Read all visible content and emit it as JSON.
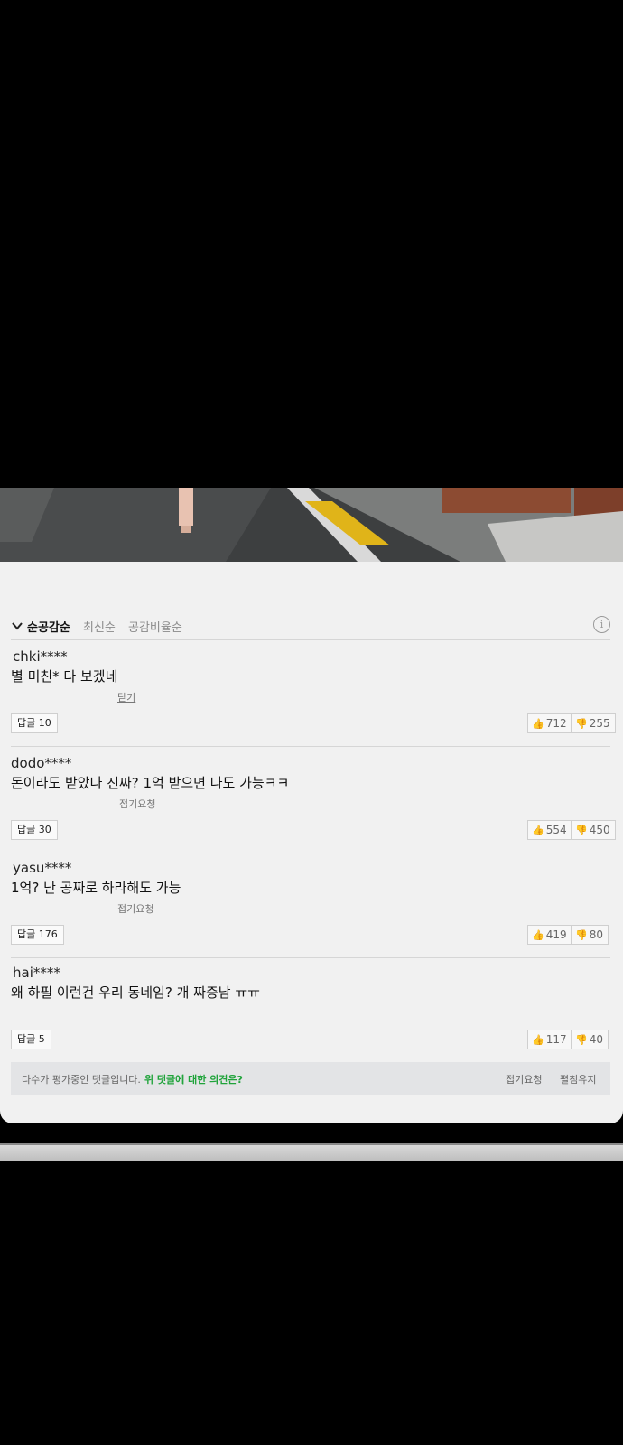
{
  "sort": {
    "options": [
      "순공감순",
      "최신순",
      "공감비율순"
    ],
    "active": "순공감순",
    "info_icon": "info-icon"
  },
  "comments": [
    {
      "user": "chki****",
      "text": "별 미친* 다 보겠네",
      "fold_label": "닫기",
      "reply_label": "답글 10",
      "likes": "712",
      "dislikes": "255"
    },
    {
      "user": "dodo****",
      "text": "돈이라도 받았나 진짜? 1억 받으면 나도 가능ㅋㅋ",
      "fold_label": "접기요청",
      "reply_label": "답글 30",
      "likes": "554",
      "dislikes": "450"
    },
    {
      "user": "yasu****",
      "text": "1억? 난 공짜로 하라해도 가능",
      "fold_label": "접기요청",
      "reply_label": "답글 176",
      "likes": "419",
      "dislikes": "80"
    },
    {
      "user": "hai****",
      "text": "왜 하필 이런건 우리 동네임? 개 짜증남 ㅠㅠ",
      "reply_label": "답글 5",
      "likes": "117",
      "dislikes": "40"
    }
  ],
  "footer": {
    "notice": "다수가 평가중인 댓글입니다.",
    "question": "위 댓글에 대한 의견은?",
    "fold_request": "접기요청",
    "keep_unfolded": "펼침유지"
  },
  "colors": {
    "panel": "#f1f1f1",
    "accent_green": "#1fa33a",
    "thumb_icon": "#d97d45",
    "road_stripe": "#e0b419"
  }
}
